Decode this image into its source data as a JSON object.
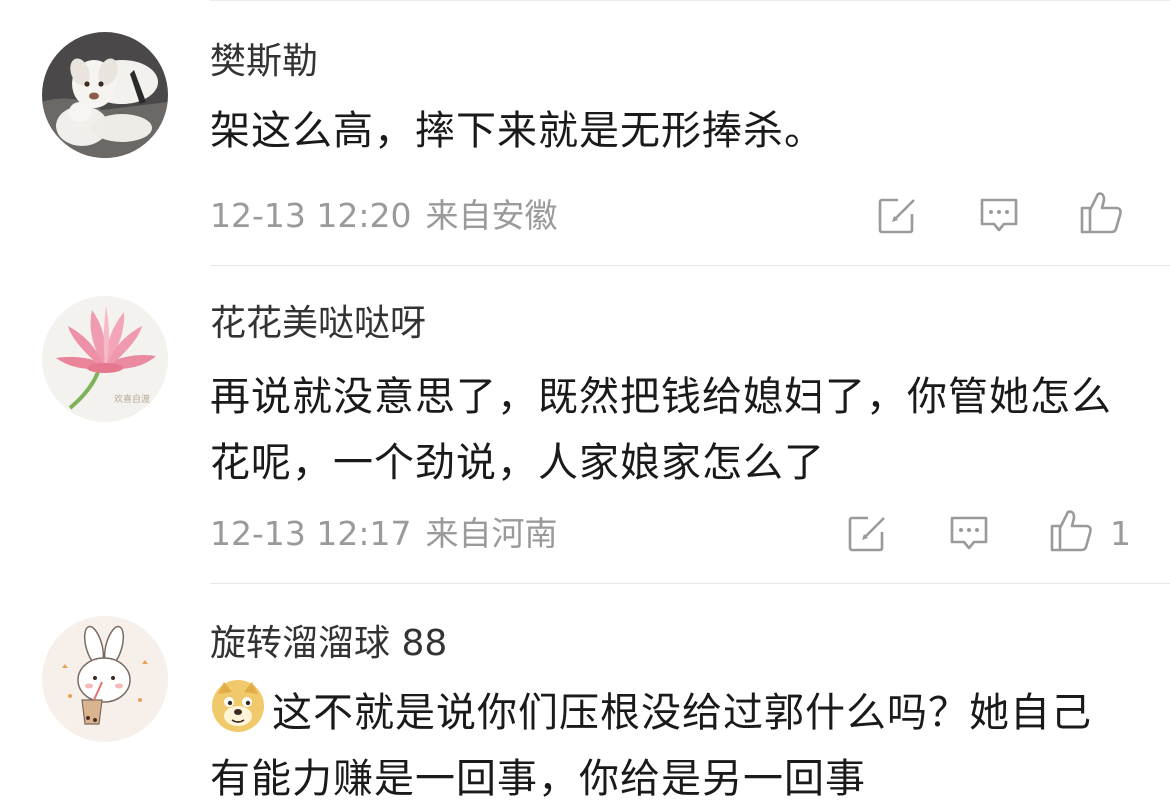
{
  "comments": [
    {
      "username": "樊斯勒",
      "text": "架这么高，摔下来就是无形捧杀。",
      "time": "12-13 12:20",
      "location": "来自安徽",
      "likes": ""
    },
    {
      "username": "花花美哒哒呀",
      "text": "再说就没意思了，既然把钱给媳妇了，你管她怎么花呢，一个劲说，人家娘家怎么了",
      "time": "12-13 12:17",
      "location": "来自河南",
      "likes": "1",
      "avatar_watermark": "欢喜自渡"
    },
    {
      "username": "旋转溜溜球 88",
      "text": "这不就是说你们压根没给过郭什么吗？她自己有能力赚是一回事，你给是另一回事",
      "emoji": "doge-emoji"
    }
  ],
  "icons": {
    "repost": "repost-icon",
    "comment": "comment-icon",
    "like": "like-icon"
  },
  "colors": {
    "text": "#1a1a1a",
    "username": "#333333",
    "meta": "#9a9a9a",
    "divider": "#e6e6e6"
  }
}
